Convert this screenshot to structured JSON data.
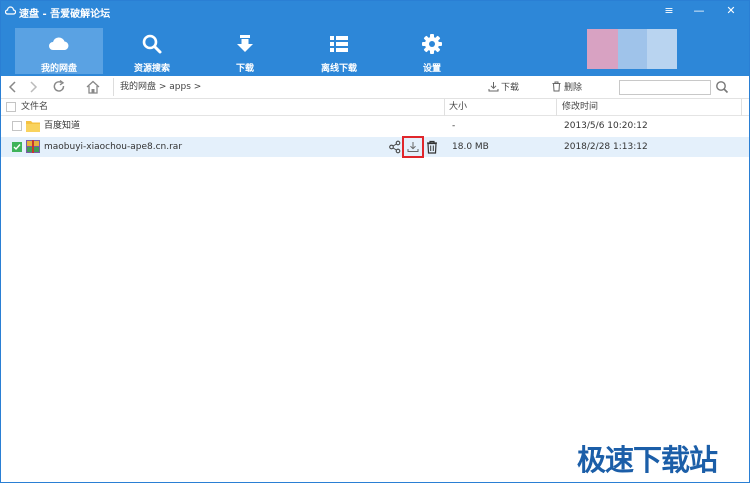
{
  "window": {
    "title": "速盘 - 吾爱破解论坛",
    "controls": [
      "≡",
      "—",
      "✕"
    ]
  },
  "nav": [
    {
      "label": "我的网盘",
      "icon": "cloud-icon",
      "active": true
    },
    {
      "label": "资源搜索",
      "icon": "search-icon",
      "active": false
    },
    {
      "label": "下载",
      "icon": "download-arrow-icon",
      "active": false
    },
    {
      "label": "离线下载",
      "icon": "list-icon",
      "active": false
    },
    {
      "label": "设置",
      "icon": "gear-icon",
      "active": false
    }
  ],
  "addressbar": {
    "breadcrumb": "我的网盘 > apps >",
    "download_label": "下载",
    "delete_label": "删除",
    "search_value": ""
  },
  "table": {
    "columns": [
      "文件名",
      "大小",
      "修改时间"
    ],
    "rows": [
      {
        "name": "百度知道",
        "type": "folder",
        "size": "-",
        "modified": "2013/5/6 10:20:12",
        "checked": false
      },
      {
        "name": "maobuyi-xiaochou-ape8.cn.rar",
        "type": "archive",
        "size": "18.0 MB",
        "modified": "2018/2/28 1:13:12",
        "checked": true
      }
    ]
  },
  "watermark": "极速下载站",
  "colors": {
    "accent": "#2d87d8",
    "active_tab": "#5aa2e3",
    "highlight": "#e0262b",
    "checked": "#3fb35a"
  }
}
